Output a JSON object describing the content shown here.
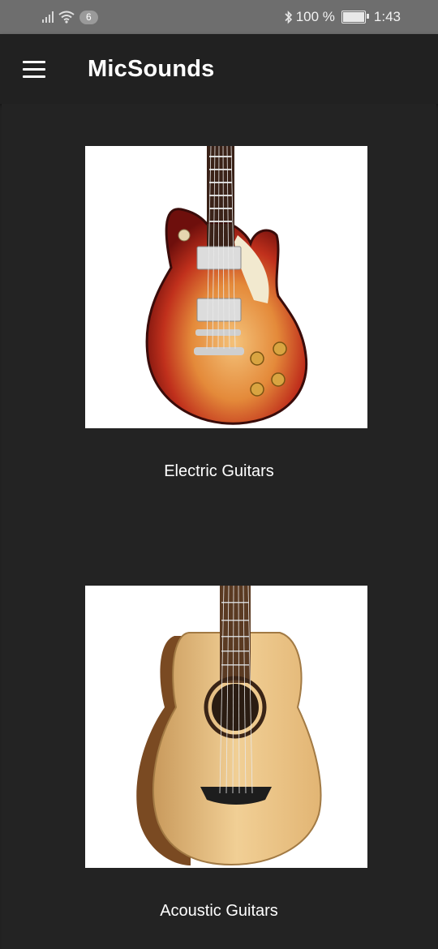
{
  "status_bar": {
    "network_badge": "6",
    "battery_percent": "100 %",
    "time": "1:43",
    "icons": [
      "signal-icon",
      "wifi-icon",
      "bluetooth-icon",
      "battery-icon"
    ]
  },
  "app_bar": {
    "title": "MicSounds",
    "menu_icon": "hamburger-menu-icon"
  },
  "categories": [
    {
      "label": "Electric Guitars",
      "image": "electric-guitar-image"
    },
    {
      "label": "Acoustic Guitars",
      "image": "acoustic-guitar-image"
    }
  ],
  "colors": {
    "background": "#212121",
    "status_bar": "#6e6e6e",
    "text": "#ffffff"
  }
}
